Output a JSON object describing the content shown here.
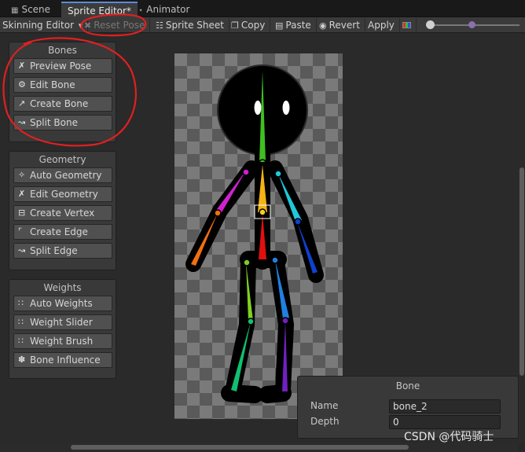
{
  "tabs": [
    {
      "label": "Scene",
      "icon": "scene-icon"
    },
    {
      "label": "Sprite Editor*",
      "icon": "sprite-editor-icon"
    },
    {
      "label": "Animator",
      "icon": "animator-icon"
    }
  ],
  "toolbar": {
    "mode_label": "Skinning Editor",
    "reset_pose": "Reset Pose",
    "sprite_sheet": "Sprite Sheet",
    "copy": "Copy",
    "paste": "Paste",
    "revert": "Revert",
    "apply": "Apply"
  },
  "bones_panel": {
    "title": "Bones",
    "buttons": [
      "Preview Pose",
      "Edit Bone",
      "Create Bone",
      "Split Bone"
    ]
  },
  "geometry_panel": {
    "title": "Geometry",
    "buttons": [
      "Auto Geometry",
      "Edit Geometry",
      "Create Vertex",
      "Create Edge",
      "Split Edge"
    ]
  },
  "weights_panel": {
    "title": "Weights",
    "buttons": [
      "Auto Weights",
      "Weight Slider",
      "Weight Brush",
      "Bone Influence"
    ]
  },
  "bone_inspector": {
    "title": "Bone",
    "name_label": "Name",
    "name_value": "bone_2",
    "depth_label": "Depth",
    "depth_value": "0"
  },
  "watermark": "CSDN @代码骑士",
  "colors": {
    "annotation": "#e02020",
    "accent": "#5b8ad8"
  }
}
